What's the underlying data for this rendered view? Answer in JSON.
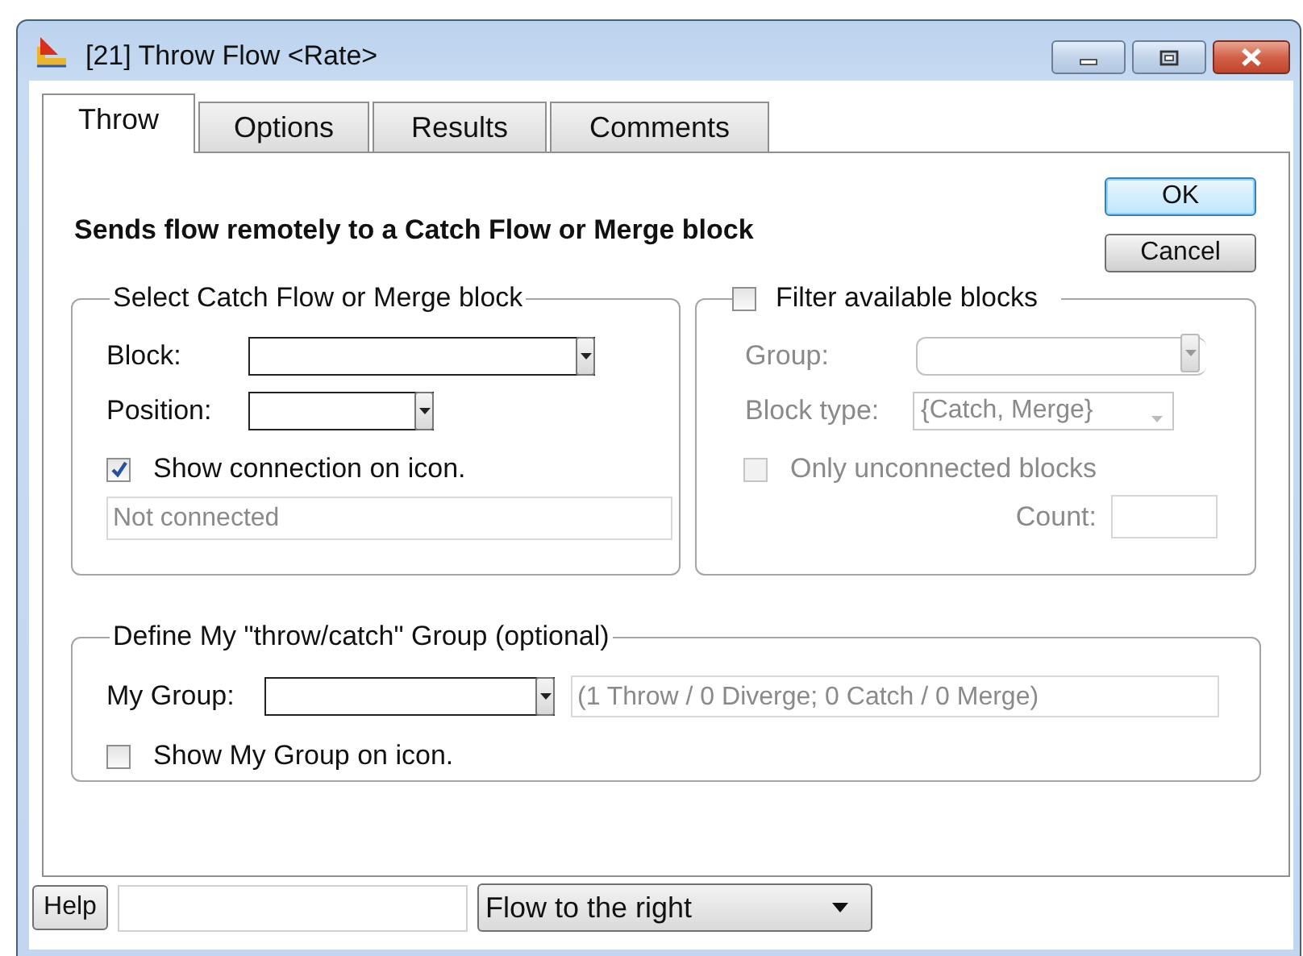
{
  "window": {
    "title": "[21] Throw Flow <Rate>"
  },
  "tabs": [
    {
      "label": "Throw",
      "selected": true
    },
    {
      "label": "Options",
      "selected": false
    },
    {
      "label": "Results",
      "selected": false
    },
    {
      "label": "Comments",
      "selected": false
    }
  ],
  "description": "Sends flow remotely to a Catch Flow or Merge block",
  "buttons": [
    {
      "label": "OK",
      "default": true
    },
    {
      "label": "Cancel",
      "default": false
    }
  ],
  "select_group": {
    "title": "Select Catch Flow or Merge block",
    "fields": [
      {
        "label": "Block:"
      },
      {
        "label": "Position:"
      }
    ],
    "show_connection": {
      "label": "Show connection on icon.",
      "checked": true
    },
    "status": "Not connected"
  },
  "filter_group": {
    "label": "Filter available blocks",
    "checked": false,
    "disabled": true,
    "group_label": "Group:",
    "block_type": {
      "label": "Block type:",
      "value": "{Catch, Merge}"
    },
    "only_unconnected": {
      "label": "Only unconnected blocks",
      "checked": false
    },
    "count_label": "Count:"
  },
  "my_group": {
    "title": "Define My \"throw/catch\" Group (optional)",
    "label": "My Group:",
    "summary": "(1 Throw / 0 Diverge; 0 Catch / 0 Merge)",
    "show_on_icon": {
      "label": "Show My Group on icon.",
      "checked": false
    }
  },
  "footer": {
    "help": "Help",
    "flow": "Flow to the right"
  }
}
